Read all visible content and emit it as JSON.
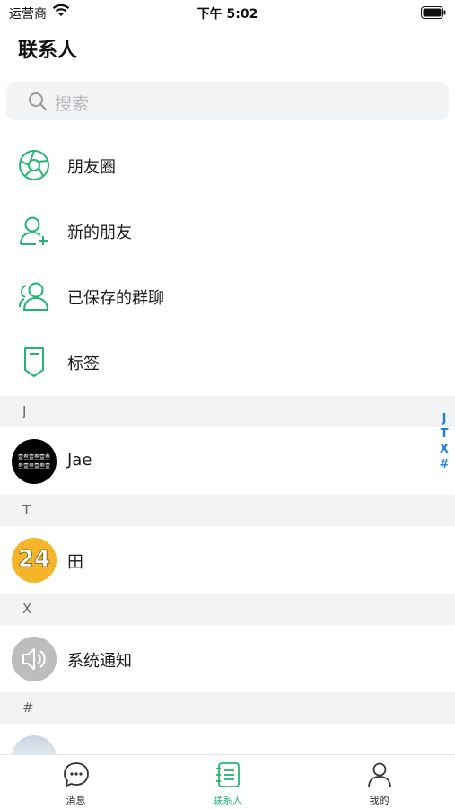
{
  "status_bar": {
    "carrier": "运营商",
    "time": "下午 5:02"
  },
  "header": {
    "title": "联系人"
  },
  "search": {
    "placeholder": "搜索"
  },
  "functions": [
    {
      "label": "朋友圈",
      "icon": "shutter-icon"
    },
    {
      "label": "新的朋友",
      "icon": "add-friend-icon"
    },
    {
      "label": "已保存的群聊",
      "icon": "group-icon"
    },
    {
      "label": "标签",
      "icon": "tag-icon"
    }
  ],
  "sections": [
    {
      "letter": "J",
      "contacts": [
        {
          "name": "Jae",
          "avatar": "black-calligraphy-avatar"
        }
      ]
    },
    {
      "letter": "T",
      "contacts": [
        {
          "name": "田",
          "avatar": "number-24-avatar"
        }
      ]
    },
    {
      "letter": "X",
      "contacts": [
        {
          "name": "系统通知",
          "avatar": "speaker-avatar"
        }
      ]
    },
    {
      "letter": "#",
      "contacts": [
        {
          "name": "",
          "avatar": "photo-avatar"
        }
      ]
    }
  ],
  "index_letters": [
    "J",
    "T",
    "X",
    "#"
  ],
  "tabbar": {
    "tabs": [
      {
        "label": "消息",
        "icon": "chat-bubble-icon",
        "active": false
      },
      {
        "label": "联系人",
        "icon": "contacts-book-icon",
        "active": true
      },
      {
        "label": "我的",
        "icon": "person-icon",
        "active": false
      }
    ]
  },
  "colors": {
    "accent": "#22b573",
    "index": "#1e7fd6",
    "section_bg": "#f2f3f5"
  }
}
